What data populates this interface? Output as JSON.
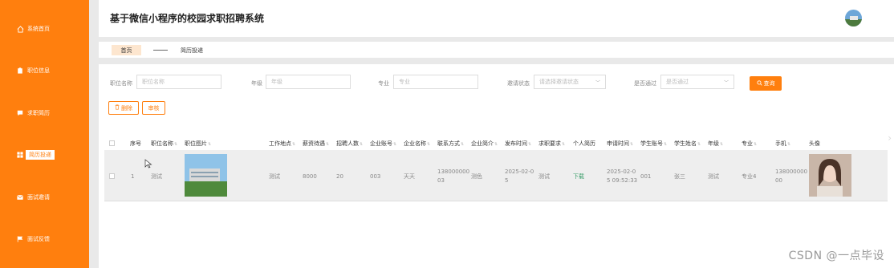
{
  "app": {
    "title": "基于微信小程序的校园求职招聘系统"
  },
  "sidebar": {
    "items": [
      {
        "label": "系统首页",
        "icon": "home-icon",
        "active": false
      },
      {
        "label": "职位信息",
        "icon": "clipboard-icon",
        "active": false
      },
      {
        "label": "求职简历",
        "icon": "comment-icon",
        "active": false
      },
      {
        "label": "简历投递",
        "icon": "grid-icon",
        "active": true
      },
      {
        "label": "面试邀请",
        "icon": "mail-icon",
        "active": false
      },
      {
        "label": "面试反馈",
        "icon": "flag-icon",
        "active": false
      }
    ]
  },
  "breadcrumb": {
    "home": "首页",
    "current": "简历投递"
  },
  "search": {
    "job_name": {
      "label": "职位名称",
      "placeholder": "职位名称"
    },
    "grade": {
      "label": "年级",
      "placeholder": "年级"
    },
    "major": {
      "label": "专业",
      "placeholder": "专业"
    },
    "invite_status": {
      "label": "邀请状态",
      "placeholder": "请选择邀请状态"
    },
    "approved": {
      "label": "是否通过",
      "placeholder": "是否通过"
    },
    "query_label": "查询"
  },
  "actions": {
    "delete_label": "删除",
    "review_label": "审核"
  },
  "table": {
    "columns": [
      "序号",
      "职位名称",
      "职位图片",
      "工作地点",
      "薪资待遇",
      "招聘人数",
      "企业账号",
      "企业名称",
      "联系方式",
      "企业简介",
      "发布时间",
      "求职要求",
      "个人简历",
      "申请时间",
      "学生账号",
      "学生姓名",
      "年级",
      "专业",
      "手机",
      "头像"
    ],
    "rows": [
      {
        "index": "1",
        "job_name": "测试",
        "location": "测试",
        "salary": "8000",
        "headcount": "20",
        "company_account": "003",
        "company_name": "天天",
        "contact_line1": "138000000",
        "contact_line2": "03",
        "intro": "测色",
        "publish_line1": "2025-02-0",
        "publish_line2": "5",
        "requirement": "测试",
        "resume": "下载",
        "apply_line1": "2025-02-0",
        "apply_line2": "5 09:52:33",
        "student_account": "001",
        "student_name": "张三",
        "grade": "测试",
        "major": "专业4",
        "phone_line1": "138000000",
        "phone_line2": "00"
      }
    ]
  },
  "watermark": "CSDN @一点毕设",
  "colors": {
    "accent": "#ff7f0e",
    "link": "#3a9e6a"
  }
}
